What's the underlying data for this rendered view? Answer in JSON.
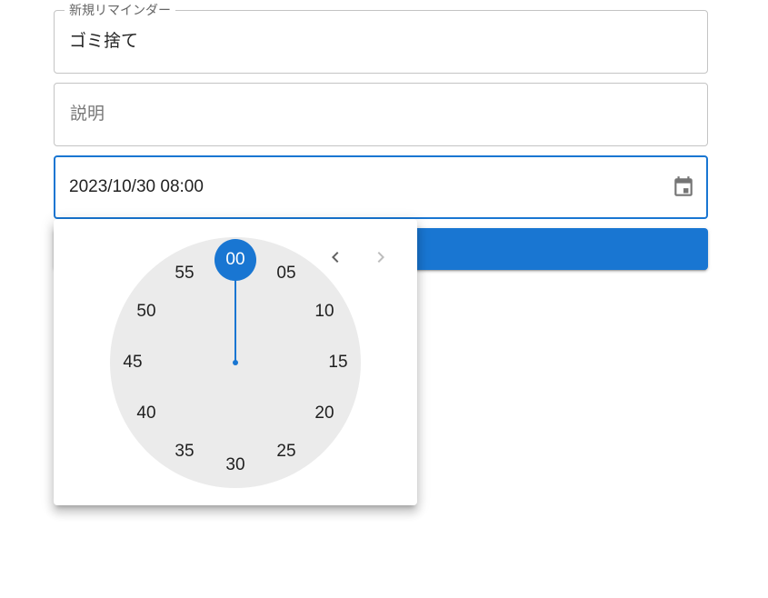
{
  "form": {
    "title_legend": "新規リマインダー",
    "title_value": "ゴミ捨て",
    "description_placeholder": "説明",
    "datetime_value": "2023/10/30 08:00"
  },
  "colors": {
    "primary": "#1976d2",
    "border": "#c4c4c4",
    "clock_face": "#ebebeb"
  },
  "icons": {
    "calendar": "calendar-icon",
    "prev": "chevron-left-icon",
    "next": "chevron-right-icon"
  },
  "time_picker": {
    "view": "minutes",
    "selected_minute": "00",
    "minutes": [
      "00",
      "05",
      "10",
      "15",
      "20",
      "25",
      "30",
      "35",
      "40",
      "45",
      "50",
      "55"
    ]
  }
}
